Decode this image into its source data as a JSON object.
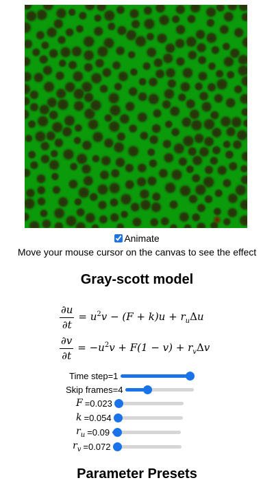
{
  "canvas": {
    "background": "#0a9a0a",
    "spot_color": "#2f3b0a",
    "marker_color": "#8b0000"
  },
  "animate": {
    "label": "Animate",
    "checked": true
  },
  "hint": "Move your mouse cursor on the canvas to see the effect",
  "model_title": "Gray-scott model",
  "equations": {
    "u": {
      "numerator": "∂u",
      "denominator": "∂t"
    },
    "v": {
      "numerator": "∂v",
      "denominator": "∂t"
    }
  },
  "controls": [
    {
      "label": "Time step=1",
      "fraction": 1.0
    },
    {
      "label": "Skip frames=4",
      "fraction": 0.32
    },
    {
      "symbol": "F",
      "value_text": "=0.023",
      "fraction": 0.05
    },
    {
      "symbol": "k",
      "value_text": "=0.054",
      "fraction": 0.05
    },
    {
      "symbol": "r",
      "sub": "u",
      "value_text": "=0.09",
      "fraction": 0.07
    },
    {
      "symbol": "r",
      "sub": "v",
      "value_text": "=0.072",
      "fraction": 0.06
    }
  ],
  "accent_color": "#1a73e8",
  "presets_title": "Parameter Presets"
}
